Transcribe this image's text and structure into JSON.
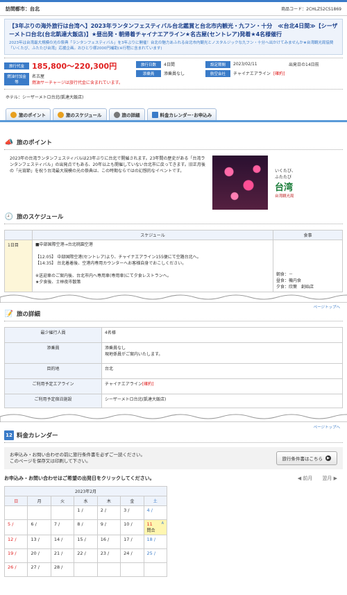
{
  "header": {
    "city_label": "訪問都市：台北",
    "product_code": "商品コード：2CHLZ52CS1869"
  },
  "title": "【3年ぶりの海外旅行は台湾へ】2023年ランタンフェスティバル台北鑑賞と台北市内観光・九フン・十分　≪台北4日間≫【シーザーメトロ台北(台北凱達大飯店)】★昼出発・朝帰着チャイナエアライン★名古屋(セントレア)発着★4名様催行",
  "description": "2023年は台湾最大規模の光の祭典「ランタンフェスティバル」を3年ぶりに開催！台北の魅力あふれる台北市内観光とノスタルジックな九フン・十分へ出かけてみませんか★台湾観光局協賛「いくたび、ふたたび台湾」応援企画。おひとり様2000円補助(※行程に含まれています)",
  "info": {
    "price_label": "旅行代金",
    "price": "185,800〜220,300円",
    "fuel_label": "燃油付加金等",
    "fuel_1": "名古屋",
    "fuel_2": "燃油サーチャージは旅行代金に含まれています。",
    "days_label": "旅行日数",
    "days": "4日間",
    "conductor_label": "添乗員",
    "conductor": "添乗員なし",
    "date_label": "設定期間",
    "date": "2023/02/11",
    "airline_label": "航空会社",
    "airline": "チャイナエアライン",
    "airline_flag": "[確約]",
    "deadline": "出発日の14日前"
  },
  "hotel": "ホテル：シーザーメトロ台北(凱達大飯店)",
  "tabs": [
    "旅のポイント",
    "旅のスケジュール",
    "旅の詳細",
    "料金カレンダー･お申込み"
  ],
  "point": {
    "heading": "旅のポイント",
    "text": "2023年の台湾ランタンフェスティバルは23年ぶりに台北で開催されます。23年間の歴史がある「台湾ランタンフェスティバル」の出発点でもある、20年以上も開催していない台北市に戻ってきます。旧正月後の「元宵節」を祝う台湾最大規模の光の祭典は、この時期ならではの幻想的なイベントです。",
    "logo_line1": "いくたび、",
    "logo_line2": "ふたたび",
    "logo_big": "台湾",
    "logo_sub": "台湾観光局"
  },
  "schedule": {
    "heading": "旅のスケジュール",
    "col_schedule": "スケジュール",
    "col_meal": "食事",
    "day": "1日目",
    "route": "■中部国際空港→台北桃園空港",
    "line1": "【12:05】 中部国際空港(セントレア)より、チャイナエアライン155便にて空路台北へ。",
    "line2": "【14:35】 台北着着後、空港内専用カウンターへお客様自身でおこしください。",
    "line3": "※送迎車のご案内後、台北市内へ専用車(専用車)にて夕食レストランへ。",
    "line4": "★夕食後、士林夜市散策",
    "meal1": "朝食：－",
    "meal2": "昼食：機内食",
    "meal3": "夕食：欣葉　創始店"
  },
  "pagetop": "ページトップへ",
  "detail": {
    "heading": "旅の詳細",
    "rows": [
      {
        "k": "最少催行人員",
        "v": "4名様"
      },
      {
        "k": "添乗員",
        "v": "添乗員なし\n現地係員がご案内いたします。"
      },
      {
        "k": "目的地",
        "v": "台北"
      },
      {
        "k": "ご利用予定エアライン",
        "v": "チャイナエアライン"
      },
      {
        "k": "ご利用予定宿泊施設",
        "v": "シーザーメトロ台北(凱達大飯店)"
      }
    ],
    "airline_flag": "[確約]"
  },
  "calendar": {
    "heading": "料金カレンダー",
    "notice1": "お申込み・お問い合わせの前に旅行条件書を必ずご一読ください。",
    "notice2": "このページを保存又は印刷して下さい。",
    "conditions_button": "旅行条件書はこちら",
    "instruction": "お申込み・お問い合わせはご希望の出発日をクリックしてください。",
    "prev": "前月",
    "next": "翌月",
    "month": "2023年2月",
    "weekdays": [
      "日",
      "月",
      "火",
      "水",
      "木",
      "金",
      "土"
    ],
    "status": "問合",
    "badge": "A"
  },
  "colors": {
    "accent": "#3a7bc8",
    "price": "#e02020",
    "tab": "#5a9ad8"
  }
}
